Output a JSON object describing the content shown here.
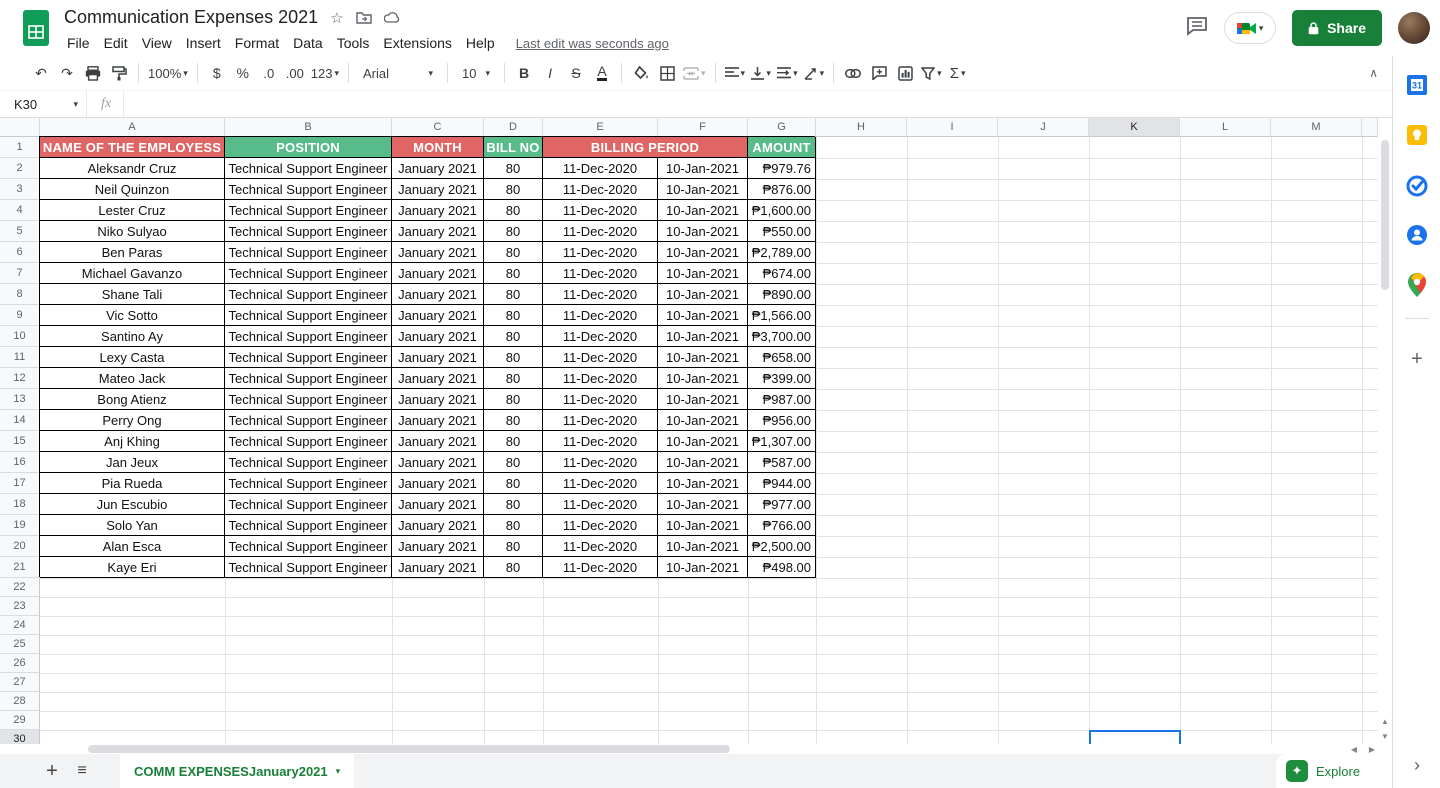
{
  "app": {
    "title": "Communication Expenses 2021",
    "menu_items": [
      "File",
      "Edit",
      "View",
      "Insert",
      "Format",
      "Data",
      "Tools",
      "Extensions",
      "Help"
    ],
    "last_edit": "Last edit was seconds ago",
    "share_label": "Share"
  },
  "toolbar": {
    "zoom": "100%",
    "font_family": "Arial",
    "font_size": "10"
  },
  "formula_bar": {
    "cell_ref": "K30",
    "fx_label": "fx"
  },
  "grid": {
    "column_letters": [
      "A",
      "B",
      "C",
      "D",
      "E",
      "F",
      "G",
      "H",
      "I",
      "J",
      "K",
      "L",
      "M"
    ],
    "row_count": 30,
    "selected_cell": "K30",
    "selected_column": "K",
    "selected_row": 30
  },
  "table": {
    "headers": [
      {
        "label": "NAME OF THE EMPLOYESS",
        "color": "#e06666"
      },
      {
        "label": "POSITION",
        "color": "#57bb8a"
      },
      {
        "label": "MONTH",
        "color": "#e06666"
      },
      {
        "label": "BILL NO",
        "color": "#57bb8a"
      },
      {
        "label": "BILLING PERIOD",
        "color": "#e06666"
      },
      {
        "label": "AMOUNT",
        "color": "#57bb8a"
      }
    ],
    "rows": [
      [
        "Aleksandr Cruz",
        "Technical Support Engineer",
        "January 2021",
        "80",
        "11-Dec-2020",
        "10-Jan-2021",
        "₱979.76"
      ],
      [
        "Neil Quinzon",
        "Technical Support Engineer",
        "January 2021",
        "80",
        "11-Dec-2020",
        "10-Jan-2021",
        "₱876.00"
      ],
      [
        "Lester Cruz",
        "Technical Support Engineer",
        "January 2021",
        "80",
        "11-Dec-2020",
        "10-Jan-2021",
        "₱1,600.00"
      ],
      [
        "Niko Sulyao",
        "Technical Support Engineer",
        "January 2021",
        "80",
        "11-Dec-2020",
        "10-Jan-2021",
        "₱550.00"
      ],
      [
        "Ben Paras",
        "Technical Support Engineer",
        "January 2021",
        "80",
        "11-Dec-2020",
        "10-Jan-2021",
        "₱2,789.00"
      ],
      [
        "Michael Gavanzo",
        "Technical Support Engineer",
        "January 2021",
        "80",
        "11-Dec-2020",
        "10-Jan-2021",
        "₱674.00"
      ],
      [
        "Shane Tali",
        "Technical Support Engineer",
        "January 2021",
        "80",
        "11-Dec-2020",
        "10-Jan-2021",
        "₱890.00"
      ],
      [
        "Vic Sotto",
        "Technical Support Engineer",
        "January 2021",
        "80",
        "11-Dec-2020",
        "10-Jan-2021",
        "₱1,566.00"
      ],
      [
        "Santino Ay",
        "Technical Support Engineer",
        "January 2021",
        "80",
        "11-Dec-2020",
        "10-Jan-2021",
        "₱3,700.00"
      ],
      [
        "Lexy Casta",
        "Technical Support Engineer",
        "January 2021",
        "80",
        "11-Dec-2020",
        "10-Jan-2021",
        "₱658.00"
      ],
      [
        "Mateo Jack",
        "Technical Support Engineer",
        "January 2021",
        "80",
        "11-Dec-2020",
        "10-Jan-2021",
        "₱399.00"
      ],
      [
        "Bong Atienz",
        "Technical Support Engineer",
        "January 2021",
        "80",
        "11-Dec-2020",
        "10-Jan-2021",
        "₱987.00"
      ],
      [
        "Perry Ong",
        "Technical Support Engineer",
        "January 2021",
        "80",
        "11-Dec-2020",
        "10-Jan-2021",
        "₱956.00"
      ],
      [
        "Anj Khing",
        "Technical Support Engineer",
        "January 2021",
        "80",
        "11-Dec-2020",
        "10-Jan-2021",
        "₱1,307.00"
      ],
      [
        "Jan Jeux",
        "Technical Support Engineer",
        "January 2021",
        "80",
        "11-Dec-2020",
        "10-Jan-2021",
        "₱587.00"
      ],
      [
        "Pia Rueda",
        "Technical Support Engineer",
        "January 2021",
        "80",
        "11-Dec-2020",
        "10-Jan-2021",
        "₱944.00"
      ],
      [
        "Jun Escubio",
        "Technical Support Engineer",
        "January 2021",
        "80",
        "11-Dec-2020",
        "10-Jan-2021",
        "₱977.00"
      ],
      [
        "Solo Yan",
        "Technical Support Engineer",
        "January 2021",
        "80",
        "11-Dec-2020",
        "10-Jan-2021",
        "₱766.00"
      ],
      [
        "Alan Esca",
        "Technical Support Engineer",
        "January 2021",
        "80",
        "11-Dec-2020",
        "10-Jan-2021",
        "₱2,500.00"
      ],
      [
        "Kaye Eri",
        "Technical Support Engineer",
        "January 2021",
        "80",
        "11-Dec-2020",
        "10-Jan-2021",
        "₱498.00"
      ]
    ]
  },
  "sheet_tabs": {
    "active_tab": "COMM EXPENSESJanuary2021"
  },
  "explore": {
    "label": "Explore"
  },
  "icons": {
    "undo": "↶",
    "redo": "↷",
    "caret": "▾",
    "dollar": "$",
    "percent": "%",
    "decrease_decimal": ".0",
    "increase_decimal": ".00",
    "more_formats": "123",
    "bold": "B",
    "italic": "I",
    "strikethrough": "S",
    "text_color": "A",
    "sigma": "Σ",
    "star": "☆",
    "collapse": "∧",
    "plus": "+",
    "hamburger": "≡",
    "chevron_right": "›",
    "sparkle": "✦",
    "calendar_day": "31",
    "scroll_up": "▲",
    "scroll_down": "▼",
    "scroll_left": "◀",
    "scroll_right": "▶"
  },
  "colors": {
    "header_red": "#e06666",
    "header_green": "#57bb8a",
    "accent_green": "#188038",
    "selection_blue": "#1a73e8"
  }
}
